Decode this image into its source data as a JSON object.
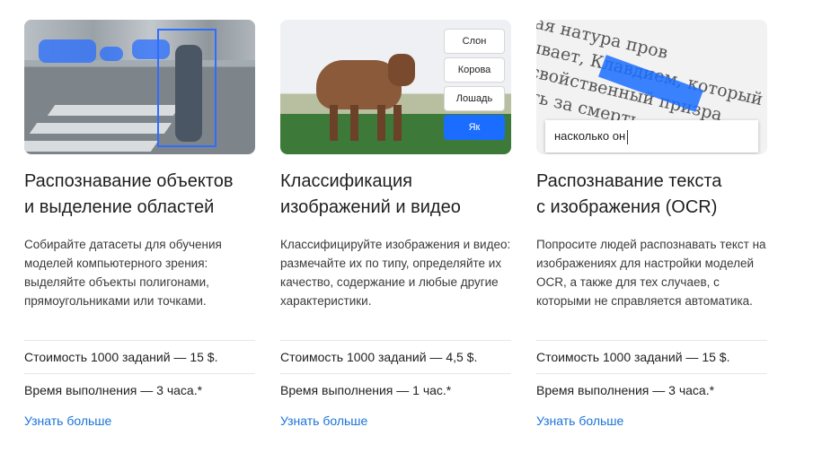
{
  "cards": [
    {
      "title": "Распознавание объектов\nи выделение областей",
      "description": "Собирайте датасеты для обучения моделей компьютерного зрения: выделяйте объекты полигонами, прямоугольниками или точками.",
      "cost": "Стоимость 1000 заданий — 15 $.",
      "time": "Время выполнения — 3 часа.*",
      "link": "Узнать больше"
    },
    {
      "title": "Классификация\nизображений и видео",
      "description": "Классифицируйте изображения и видео: размечайте их по типу, определяйте их качество, содержание и любые другие характеристики.",
      "cost": "Стоимость 1000 заданий — 4,5 $.",
      "time": "Время выполнения — 1 час.*",
      "link": "Узнать больше",
      "options": [
        "Слон",
        "Корова",
        "Лошадь",
        "Як"
      ],
      "selected_option": "Як"
    },
    {
      "title": "Распознавание текста\nс изображения (OCR)",
      "description": "Попросите людей распознавать текст на изображениях для настройки моделей OCR, а также для тех случаев, с которыми не справляется автоматика.",
      "cost": "Стоимость 1000 заданий — 15 $.",
      "time": "Время выполнения — 3 часа.*",
      "link": "Узнать больше",
      "ocr_input": "насколько он",
      "ocr_background_text": "дая натура пров\nзывает, Клавдием, который тепер\nи свойственный призра\nчить за смерть"
    }
  ],
  "colors": {
    "link": "#1a73d9",
    "accent": "#1a6dff"
  }
}
